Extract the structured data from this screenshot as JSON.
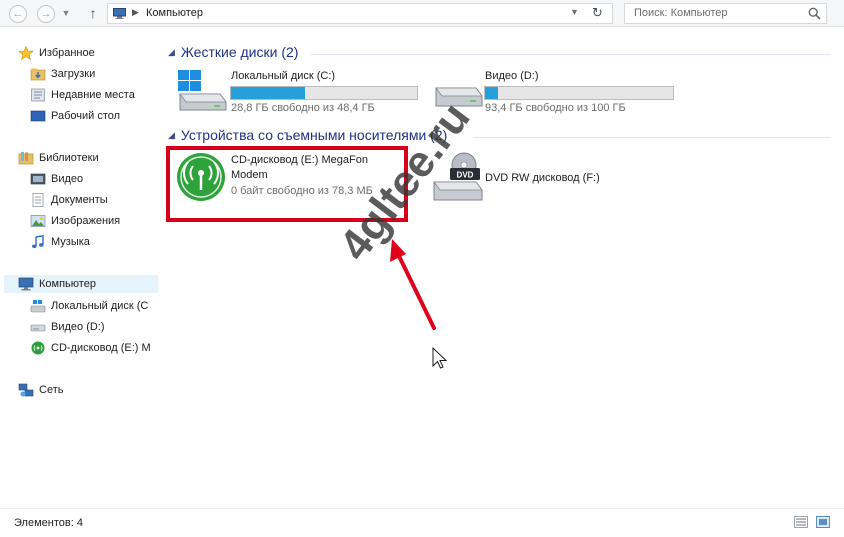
{
  "address": {
    "crumb": "Компьютер",
    "search_placeholder": "Поиск: Компьютер"
  },
  "nav_pane": {
    "favorites": "Избранное",
    "downloads": "Загрузки",
    "recent": "Недавние места",
    "desktop": "Рабочий стол",
    "libraries": "Библиотеки",
    "video": "Видео",
    "documents": "Документы",
    "images": "Изображения",
    "music": "Музыка",
    "computer": "Компьютер",
    "local_disk": "Локальный диск (C",
    "video_disk": "Видео (D:)",
    "cd_drive": "CD-дисковод (E:) M",
    "network": "Сеть"
  },
  "groups": {
    "hard_disks": "Жесткие диски (2)",
    "removable": "Устройства со съемными носителями (2)"
  },
  "drives": [
    {
      "name": "Локальный диск (C:)",
      "free": "28,8 ГБ свободно из 48,4 ГБ",
      "used_fraction": 0.4
    },
    {
      "name": "Видео (D:)",
      "free": "93,4 ГБ свободно из 100 ГБ",
      "used_fraction": 0.07
    }
  ],
  "removable": [
    {
      "name_line1": "CD-дисковод (E:) MegaFon",
      "name_line2": "Modem",
      "free": "0 байт свободно из 78,3 МБ"
    },
    {
      "name": "DVD RW дисковод (F:)",
      "icon_label": "DVD"
    }
  ],
  "watermark": "4gltee.ru",
  "status": {
    "items": "Элементов: 4"
  },
  "colors": {
    "highlight": "#d7001b",
    "arrow": "#e0001b",
    "bar_fill": "#26a0da",
    "group_header": "#1e3287"
  }
}
